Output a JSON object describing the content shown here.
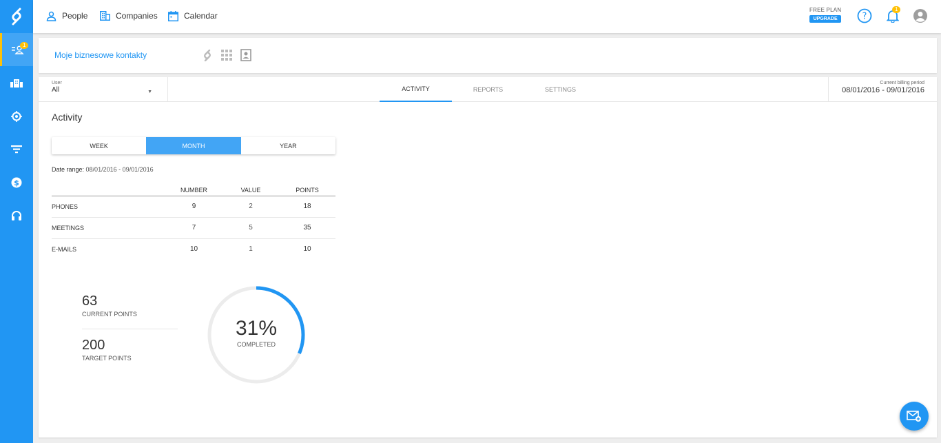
{
  "nav": {
    "people": "People",
    "companies": "Companies",
    "calendar": "Calendar"
  },
  "plan": {
    "label": "FREE PLAN",
    "upgrade": "UPGRADE"
  },
  "notifications": {
    "count": "1"
  },
  "sidebar": {
    "badge": "1",
    "items": [
      "contacts-icon",
      "companies-icon",
      "target-icon",
      "funnel-icon",
      "money-icon",
      "support-icon"
    ]
  },
  "contact": {
    "title": "Moje biznesowe kontakty"
  },
  "filter": {
    "user_label": "User",
    "user_value": "All"
  },
  "tabs": [
    "ACTIVITY",
    "REPORTS",
    "SETTINGS"
  ],
  "billing": {
    "label": "Current billing period",
    "value": "08/01/2016 - 09/01/2016"
  },
  "activity": {
    "title": "Activity",
    "periods": [
      "WEEK",
      "MONTH",
      "YEAR"
    ],
    "selected_period": "MONTH",
    "date_range_label": "Date range:",
    "date_range_value": "08/01/2016 - 09/01/2016",
    "table": {
      "headers": [
        "NUMBER",
        "VALUE",
        "POINTS"
      ],
      "rows": [
        {
          "label": "PHONES",
          "number": "9",
          "value": "2",
          "points": "18"
        },
        {
          "label": "MEETINGS",
          "number": "7",
          "value": "5",
          "points": "35"
        },
        {
          "label": "E-MAILS",
          "number": "10",
          "value": "1",
          "points": "10"
        }
      ]
    },
    "current_points": "63",
    "current_points_label": "CURRENT POINTS",
    "target_points": "200",
    "target_points_label": "TARGET POINTS",
    "completed_percent": "31%",
    "completed_fraction": 0.315,
    "completed_label": "COMPLETED"
  },
  "colors": {
    "accent": "#2196f3",
    "badge": "#ffc107",
    "ring_track": "#ececec"
  }
}
